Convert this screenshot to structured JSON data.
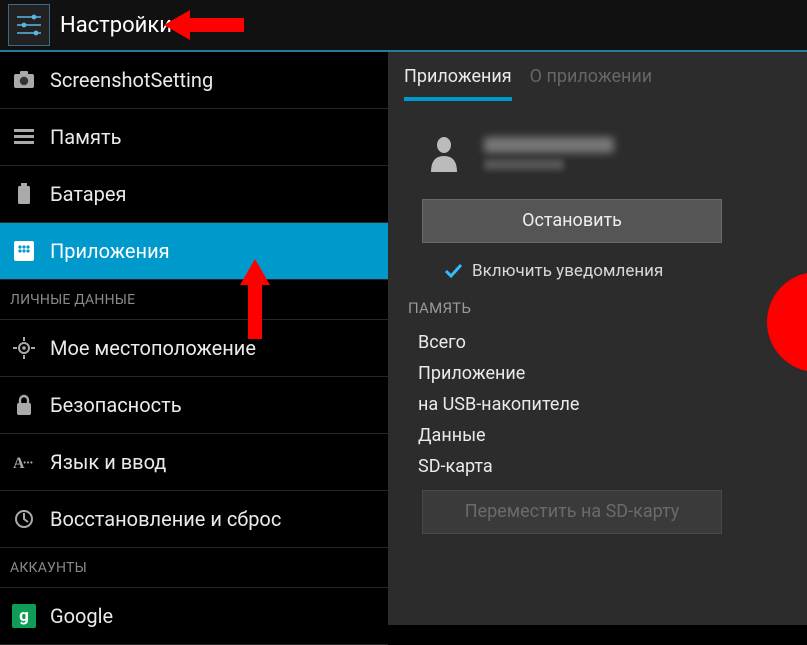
{
  "header": {
    "title": "Настройки"
  },
  "sidebar": {
    "items": [
      {
        "label": "ScreenshotSetting"
      },
      {
        "label": "Память"
      },
      {
        "label": "Батарея"
      },
      {
        "label": "Приложения"
      },
      {
        "label": "Мое местоположение"
      },
      {
        "label": "Безопасность"
      },
      {
        "label": "Язык и ввод"
      },
      {
        "label": "Восстановление и сброс"
      },
      {
        "label": "Google"
      }
    ],
    "sections": {
      "personal": "ЛИЧНЫЕ ДАННЫЕ",
      "accounts": "АККАУНТЫ"
    }
  },
  "detail": {
    "tabs": {
      "active": "Приложения",
      "inactive": "О приложении"
    },
    "stop_button": "Остановить",
    "notifications_checkbox": "Включить уведомления",
    "memory_section": "ПАМЯТЬ",
    "rows": {
      "r0": "Всего",
      "r1": "Приложение",
      "r2": "на USB-накопителе",
      "r3": "Данные",
      "r4": "SD-карта"
    },
    "move_button": "Переместить на SD-карту"
  }
}
